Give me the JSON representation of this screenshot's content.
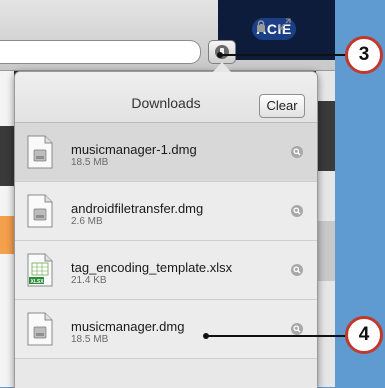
{
  "browser": {
    "logo_text": "ACIE"
  },
  "downloads": {
    "title": "Downloads",
    "clear_label": "Clear",
    "items": [
      {
        "name": "musicmanager-1.dmg",
        "size": "18.5 MB",
        "type": "dmg",
        "selected": true
      },
      {
        "name": "androidfiletransfer.dmg",
        "size": "2.6 MB",
        "type": "dmg",
        "selected": false
      },
      {
        "name": "tag_encoding_template.xlsx",
        "size": "21.4 KB",
        "type": "xlsx",
        "selected": false
      },
      {
        "name": "musicmanager.dmg",
        "size": "18.5 MB",
        "type": "dmg",
        "selected": false
      }
    ]
  },
  "callouts": [
    {
      "label": "3"
    },
    {
      "label": "4"
    }
  ],
  "colors": {
    "callout_border": "#c0392b",
    "background": "#5f9ad0"
  }
}
